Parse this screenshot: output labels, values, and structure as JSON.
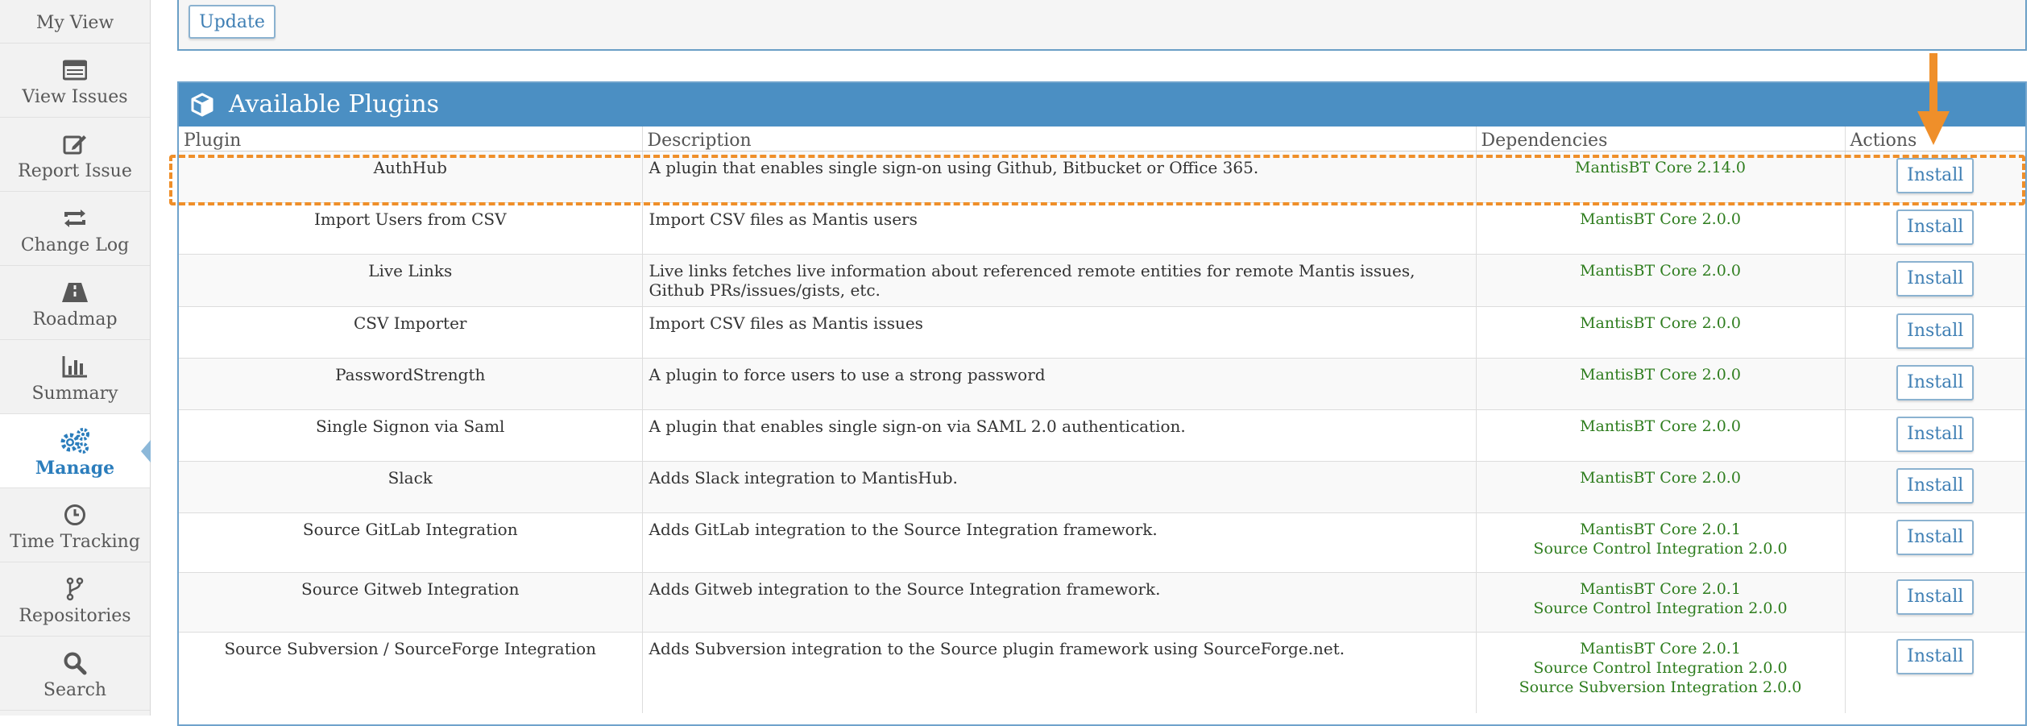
{
  "sidebar": {
    "items": [
      {
        "label": "My View",
        "icon": "dashboard-icon"
      },
      {
        "label": "View Issues",
        "icon": "list-icon"
      },
      {
        "label": "Report Issue",
        "icon": "edit-icon"
      },
      {
        "label": "Change Log",
        "icon": "retweet-icon"
      },
      {
        "label": "Roadmap",
        "icon": "road-icon"
      },
      {
        "label": "Summary",
        "icon": "bar-chart-icon"
      },
      {
        "label": "Manage",
        "icon": "gears-icon",
        "active": true
      },
      {
        "label": "Time Tracking",
        "icon": "clock-icon"
      },
      {
        "label": "Repositories",
        "icon": "code-fork-icon"
      },
      {
        "label": "Search",
        "icon": "search-icon"
      }
    ]
  },
  "top": {
    "update_label": "Update"
  },
  "plugins_widget": {
    "title": "Available Plugins",
    "icon": "cube-icon",
    "columns": [
      "Plugin",
      "Description",
      "Dependencies",
      "Actions"
    ],
    "install_label": "Install",
    "rows": [
      {
        "name": "AuthHub",
        "description": "A plugin that enables single sign-on using Github, Bitbucket or Office 365.",
        "dependencies": [
          "MantisBT Core 2.14.0"
        ]
      },
      {
        "name": "Import Users from CSV",
        "description": "Import CSV files as Mantis users",
        "dependencies": [
          "MantisBT Core 2.0.0"
        ]
      },
      {
        "name": "Live Links",
        "description": "Live links fetches live information about referenced remote entities for remote Mantis issues, Github PRs/issues/gists, etc.",
        "dependencies": [
          "MantisBT Core 2.0.0"
        ]
      },
      {
        "name": "CSV Importer",
        "description": "Import CSV files as Mantis issues",
        "dependencies": [
          "MantisBT Core 2.0.0"
        ]
      },
      {
        "name": "PasswordStrength",
        "description": "A plugin to force users to use a strong password",
        "dependencies": [
          "MantisBT Core 2.0.0"
        ]
      },
      {
        "name": "Single Signon via Saml",
        "description": "A plugin that enables single sign-on via SAML 2.0 authentication.",
        "dependencies": [
          "MantisBT Core 2.0.0"
        ]
      },
      {
        "name": "Slack",
        "description": "Adds Slack integration to MantisHub.",
        "dependencies": [
          "MantisBT Core 2.0.0"
        ]
      },
      {
        "name": "Source GitLab Integration",
        "description": "Adds GitLab integration to the Source Integration framework.",
        "dependencies": [
          "MantisBT Core 2.0.1",
          "Source Control Integration 2.0.0"
        ]
      },
      {
        "name": "Source Gitweb Integration",
        "description": "Adds Gitweb integration to the Source Integration framework.",
        "dependencies": [
          "MantisBT Core 2.0.1",
          "Source Control Integration 2.0.0"
        ]
      },
      {
        "name": "Source Subversion / SourceForge Integration",
        "description": "Adds Subversion integration to the Source plugin framework using SourceForge.net.",
        "dependencies": [
          "MantisBT Core 2.0.1",
          "Source Control Integration 2.0.0",
          "Source Subversion Integration 2.0.0"
        ]
      }
    ]
  },
  "annotation": {
    "color": "#ef8f2a",
    "highlighted_row": "AuthHub"
  }
}
